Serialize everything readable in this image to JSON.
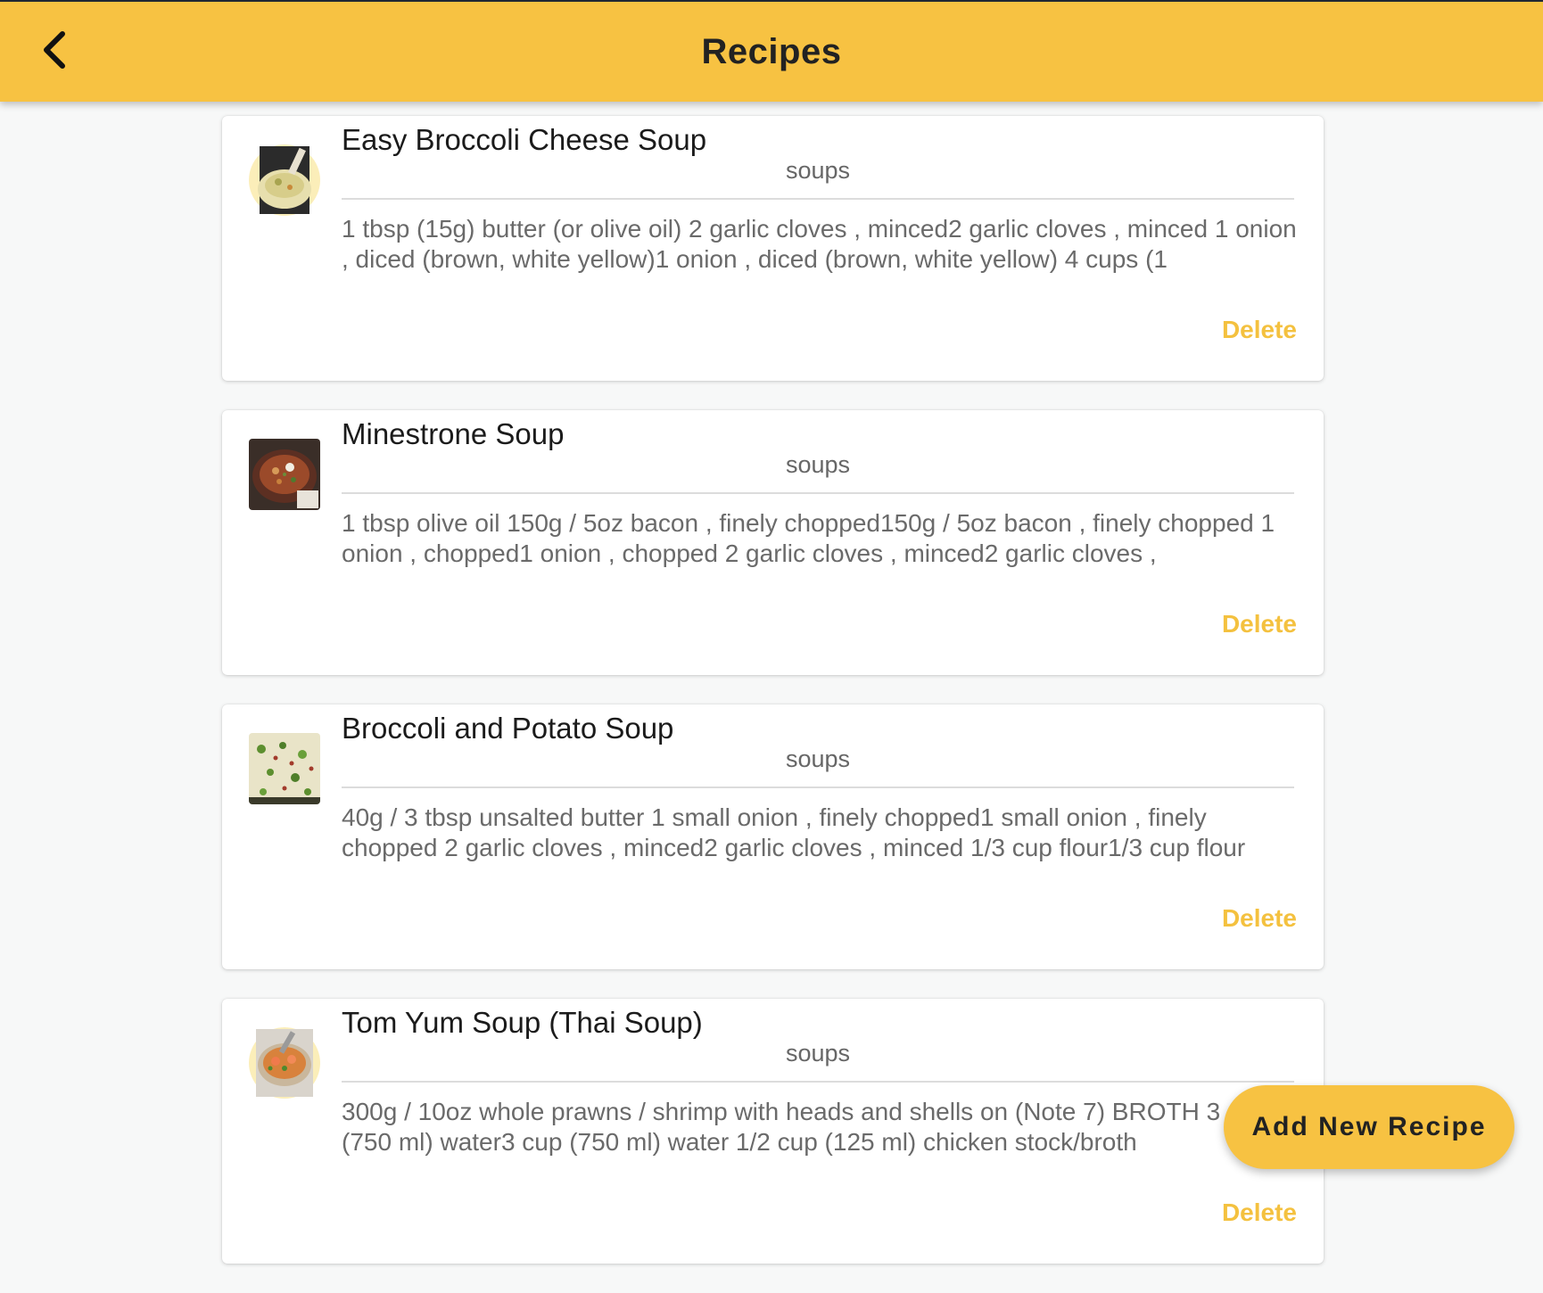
{
  "header": {
    "title": "Recipes",
    "back_icon": "chevron-left-icon"
  },
  "colors": {
    "accent": "#f7c242",
    "delete_text": "#f4c13f",
    "background": "#f7f8f8"
  },
  "recipes": [
    {
      "title": "Easy Broccoli Cheese Soup",
      "category": "soups",
      "ingredients": "1 tbsp (15g) butter (or olive oil) 2 garlic cloves , minced2 garlic cloves , minced 1 onion , diced (brown, white yellow)1 onion , diced (brown, white yellow) 4 cups (1",
      "delete_label": "Delete",
      "image_icon": "broccoli-cheese-soup-image"
    },
    {
      "title": "Minestrone Soup",
      "category": "soups",
      "ingredients": "1 tbsp olive oil 150g / 5oz bacon , finely chopped150g / 5oz bacon , finely chopped 1 onion , chopped1 onion , chopped 2 garlic cloves , minced2 garlic cloves ,",
      "delete_label": "Delete",
      "image_icon": "minestrone-soup-image"
    },
    {
      "title": "Broccoli and Potato Soup",
      "category": "soups",
      "ingredients": "40g / 3 tbsp unsalted butter 1 small onion , finely chopped1 small onion , finely chopped 2 garlic cloves , minced2 garlic cloves , minced 1/3 cup flour1/3 cup flour",
      "delete_label": "Delete",
      "image_icon": "broccoli-potato-soup-image"
    },
    {
      "title": "Tom Yum Soup (Thai Soup)",
      "category": "soups",
      "ingredients": "300g / 10oz whole prawns / shrimp with heads and shells on (Note 7) BROTH 3 cup (750 ml) water3 cup (750 ml) water 1/2 cup (125 ml) chicken stock/broth",
      "delete_label": "Delete",
      "image_icon": "tom-yum-soup-image"
    }
  ],
  "fab": {
    "label": "Add New Recipe"
  }
}
